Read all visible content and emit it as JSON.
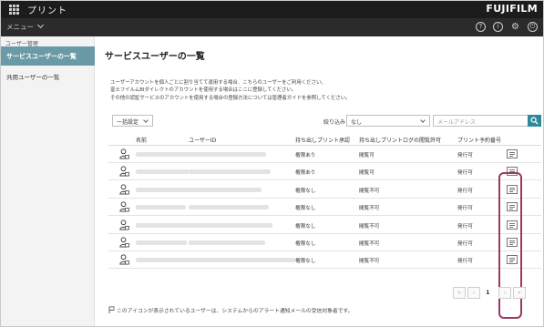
{
  "app": {
    "title": "プリント",
    "brand": "FUJIFILM",
    "menu_label": "メニュー"
  },
  "top_icons": [
    {
      "name": "help-icon",
      "glyph": "?"
    },
    {
      "name": "info-icon",
      "glyph": "i"
    },
    {
      "name": "gear-icon",
      "glyph": "⚙"
    },
    {
      "name": "power-icon",
      "glyph": "⏻"
    }
  ],
  "sidebar": {
    "group_label": "ユーザー管理",
    "active_item": "サービスユーザーの一覧",
    "item": "共用ユーザーの一覧"
  },
  "page": {
    "title": "サービスユーザーの一覧",
    "description": [
      "ユーザーアカウントを個人ごとに割り当てて運用する場合、こちらのユーザーをご利用ください。",
      "富士フイルムBIダイレクトのアカウントを使用する場合はここに登録してください。",
      "その他の認証サービスのアカウントを使用する場合の登録方法については管理者ガイドを参照してください。"
    ]
  },
  "filters": {
    "bulk_select": "一括設定",
    "narrow_label": "絞り込み",
    "narrow_value": "なし",
    "search_placeholder": "メールアドレス"
  },
  "table": {
    "headers": [
      "名前",
      "ユーザーID",
      "持ち出しプリント承認",
      "持ち出しプリントログの閲覧許可",
      "プリント予約番号"
    ],
    "rows": [
      {
        "approval": "権限あり",
        "log_access": "閲覧可",
        "reservation": "発行可"
      },
      {
        "approval": "権限あり",
        "log_access": "閲覧可",
        "reservation": "発行可"
      },
      {
        "approval": "権限なし",
        "log_access": "閲覧不可",
        "reservation": "発行可"
      },
      {
        "approval": "権限なし",
        "log_access": "閲覧不可",
        "reservation": "発行可"
      },
      {
        "approval": "権限なし",
        "log_access": "閲覧不可",
        "reservation": "発行可"
      },
      {
        "approval": "権限なし",
        "log_access": "閲覧不可",
        "reservation": "発行可"
      },
      {
        "approval": "権限なし",
        "log_access": "閲覧不可",
        "reservation": "発行可"
      }
    ]
  },
  "pagination": {
    "first": "«",
    "prev": "‹",
    "current": "1",
    "next": "›",
    "last": "»"
  },
  "footnote": "このアイコンが表示されているユーザーは、システムからのアラート通知メールの受信対象者です。",
  "colors": {
    "topbar": "#1c1c1c",
    "sidebar_active": "#6a9aa6",
    "search_button": "#2c8a9a",
    "highlight": "#9a3a63"
  }
}
